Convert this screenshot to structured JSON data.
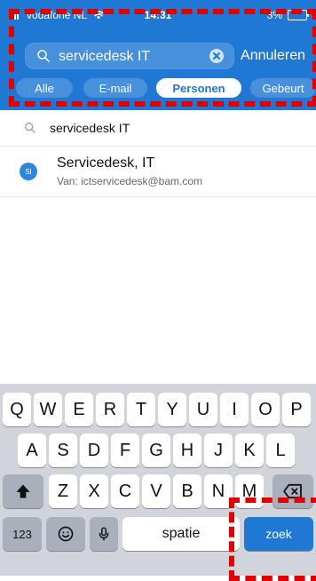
{
  "status_bar": {
    "carrier": "vodafone NL",
    "time": "14:31",
    "battery": "3%",
    "wifi_icon": "wifi-icon",
    "signal_icon": "signal-icon",
    "battery_icon": "battery-icon"
  },
  "search": {
    "query": "servicedesk IT",
    "placeholder": "",
    "cancel_label": "Annuleren"
  },
  "filters": [
    {
      "label": "Alle"
    },
    {
      "label": "E-mail"
    },
    {
      "label": "Personen",
      "active": true
    },
    {
      "label": "Gebeurt"
    }
  ],
  "results": {
    "suggestion": "servicedesk IT",
    "people": [
      {
        "avatar": "SI",
        "name": "Servicedesk, IT",
        "email": "Van: ictservicedesk@bam.com"
      }
    ]
  },
  "keyboard": {
    "row1": [
      "Q",
      "W",
      "E",
      "R",
      "T",
      "Y",
      "U",
      "I",
      "O",
      "P"
    ],
    "row2": [
      "A",
      "S",
      "D",
      "F",
      "G",
      "H",
      "J",
      "K",
      "L"
    ],
    "row3": [
      "Z",
      "X",
      "C",
      "V",
      "B",
      "N",
      "M"
    ],
    "row4": {
      "numbers": "123",
      "emoji_icon": "emoji-icon",
      "mic_icon": "mic-icon",
      "space": "spatie",
      "go": "zoek"
    },
    "shift_icon": "shift-icon",
    "delete_icon": "delete-icon"
  },
  "colors": {
    "header_blue": "#1f78d4",
    "keyboard_bg": "#d1d5db",
    "overlay_red": "#e00000"
  }
}
